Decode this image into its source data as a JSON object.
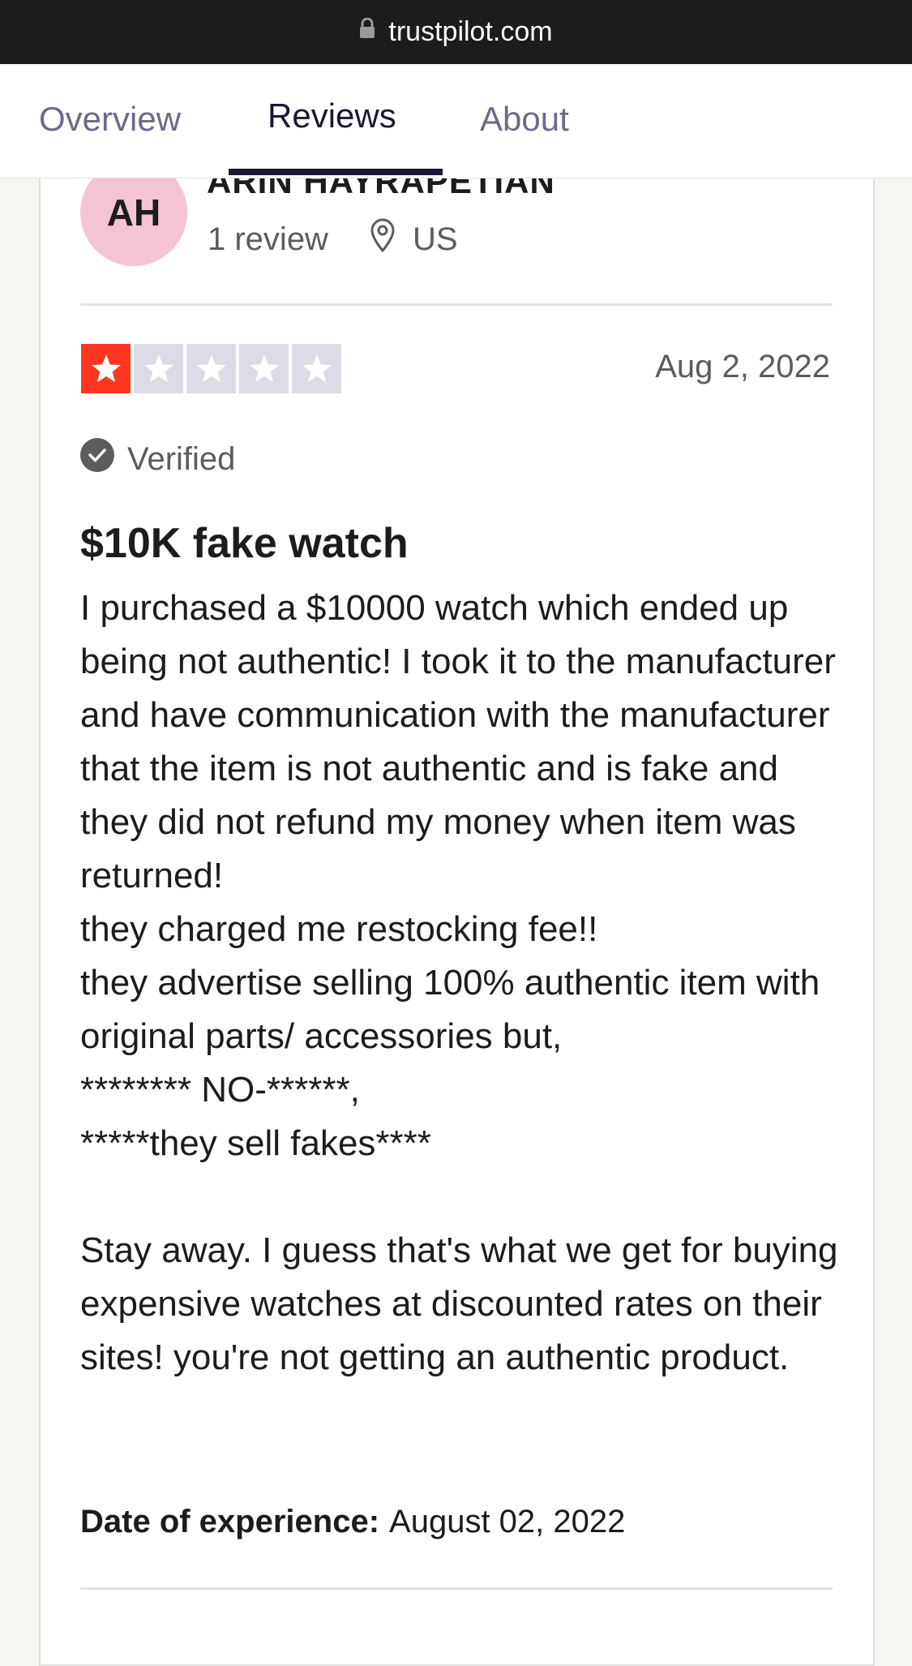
{
  "browser": {
    "url": "trustpilot.com"
  },
  "tabs": [
    {
      "label": "Overview",
      "active": false
    },
    {
      "label": "Reviews",
      "active": true
    },
    {
      "label": "About",
      "active": false
    }
  ],
  "reviewer": {
    "initials": "AH",
    "name": "ARIN HAYRAPETIAN",
    "review_count": "1 review",
    "country": "US",
    "avatar_color": "#f5c4d2"
  },
  "review": {
    "rating": 1,
    "max_rating": 5,
    "date": "Aug 2, 2022",
    "verified_label": "Verified",
    "title": "$10K fake watch",
    "body": "I purchased a $10000 watch which ended up being not authentic! I took it to the manufacturer and have communication with the manufacturer that the item is not authentic and is fake and they did not refund my money when item was returned!\nthey charged me restocking fee!!\nthey advertise selling 100% authentic item with original parts/ accessories but,\n******** NO-******,\n*****they sell fakes****\n\nStay away. I guess that's what we get for buying expensive watches at discounted rates on their sites! you're not getting an authentic product.",
    "experience_label": "Date of experience:",
    "experience_date": "August 02, 2022"
  },
  "icons": {
    "url_lock": "lock-icon",
    "location": "location-pin-icon",
    "verified": "check-circle-icon",
    "star": "star-icon"
  },
  "colors": {
    "star_filled": "#ff3722",
    "star_empty": "#dcdce6",
    "tab_active": "#191934"
  }
}
